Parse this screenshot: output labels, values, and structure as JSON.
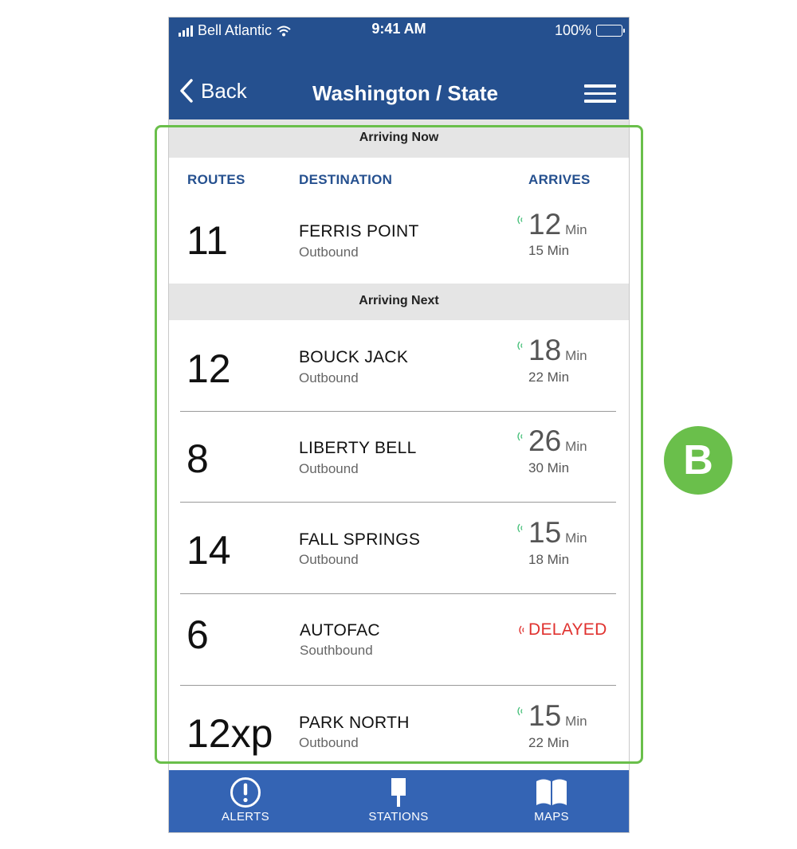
{
  "status_bar": {
    "carrier": "Bell Atlantic",
    "time": "9:41 AM",
    "battery": "100%"
  },
  "nav": {
    "back_label": "Back",
    "title": "Washington / State"
  },
  "sections": {
    "arriving_now": "Arriving Now",
    "arriving_next": "Arriving Next"
  },
  "columns": {
    "routes": "ROUTES",
    "destination": "DESTINATION",
    "arrives": "ARRIVES"
  },
  "rows": [
    {
      "route": "11",
      "destination": "FERRIS POINT",
      "direction": "Outbound",
      "arrives": "12",
      "unit": "Min",
      "next": "15 Min"
    },
    {
      "route": "12",
      "destination": "BOUCK JACK",
      "direction": "Outbound",
      "arrives": "18",
      "unit": "Min",
      "next": "22 Min"
    },
    {
      "route": "8",
      "destination": "LIBERTY BELL",
      "direction": "Outbound",
      "arrives": "26",
      "unit": "Min",
      "next": "30 Min"
    },
    {
      "route": "14",
      "destination": "FALL SPRINGS",
      "direction": "Outbound",
      "arrives": "15",
      "unit": "Min",
      "next": "18 Min"
    },
    {
      "route": "6",
      "destination": "AUTOFAC",
      "direction": "Southbound",
      "status": "DELAYED"
    },
    {
      "route": "12xp",
      "destination": "PARK NORTH",
      "direction": "Outbound",
      "arrives": "15",
      "unit": "Min",
      "next": "22 Min"
    }
  ],
  "tabs": {
    "alerts": "ALERTS",
    "stations": "STATIONS",
    "maps": "MAPS"
  },
  "callout": {
    "label": "B"
  },
  "colors": {
    "nav_bar": "#25508f",
    "tab_bar": "#3464b4",
    "header_text": "#25508f",
    "realtime_icon": "#47c07a",
    "delayed": "#e0322f",
    "highlight": "#6abf4b"
  },
  "icons": [
    "signal-icon",
    "wifi-icon",
    "battery-icon",
    "back-chevron-icon",
    "hamburger-menu-icon",
    "realtime-icon",
    "alert-icon",
    "station-icon",
    "map-icon"
  ]
}
